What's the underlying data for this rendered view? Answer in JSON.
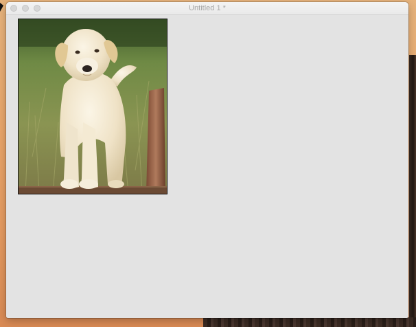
{
  "window": {
    "title": "Untitled 1 *"
  },
  "photo": {
    "subject": "puppy-photo"
  },
  "colors": {
    "window_bg": "#e3e3e3",
    "title_text": "#a8a8a8",
    "desktop": "#e8a56a"
  }
}
